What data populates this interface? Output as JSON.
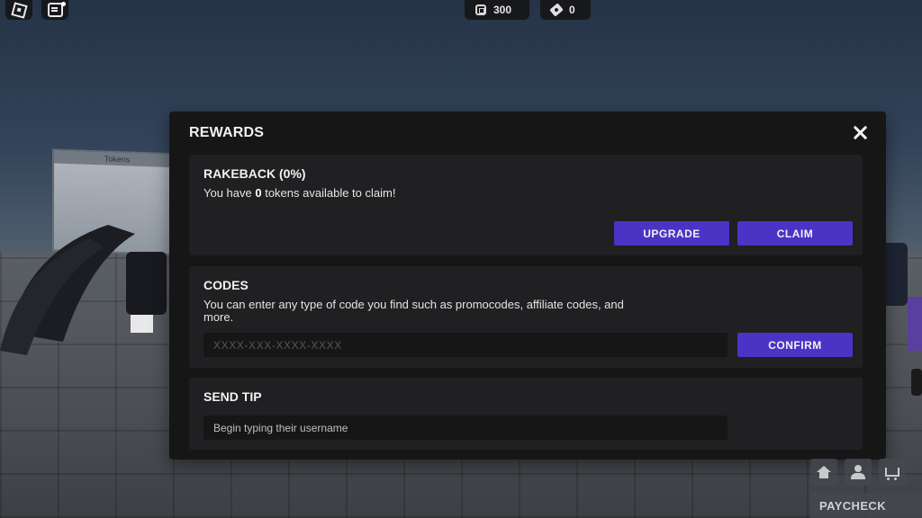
{
  "top_bar": {
    "robux_amount": "300",
    "tickets_amount": "0"
  },
  "background": {
    "sign_header": "Tokens"
  },
  "rewards": {
    "title": "REWARDS",
    "rakeback": {
      "title": "RAKEBACK (0%)",
      "desc_prefix": "You have ",
      "tokens": "0",
      "desc_suffix": " tokens available to claim!",
      "upgrade_label": "UPGRADE",
      "claim_label": "CLAIM"
    },
    "codes": {
      "title": "CODES",
      "description": "You can enter any type of code you find such as promocodes, affiliate codes, and more.",
      "placeholder": "XXXX-XXX-XXXX-XXXX",
      "confirm_label": "CONFIRM"
    },
    "send_tip": {
      "title": "SEND TIP",
      "placeholder": "Begin typing their username"
    }
  },
  "hud": {
    "paycheck_label": "PAYCHECK"
  },
  "icons": [
    "roblox-menu-icon",
    "chat-icon",
    "robux-icon",
    "ticket-icon",
    "close-icon",
    "home-icon",
    "profile-icon",
    "cart-icon"
  ],
  "colors": {
    "accent_button": "#4b33c6",
    "modal_bg": "#161617",
    "section_bg": "#202022"
  }
}
